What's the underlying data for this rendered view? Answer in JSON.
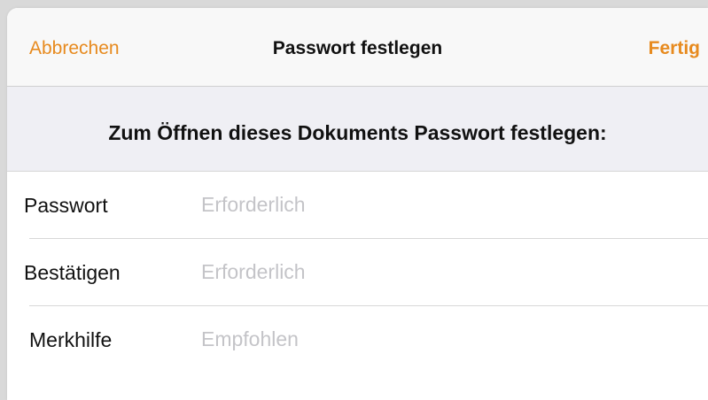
{
  "navbar": {
    "cancel_label": "Abbrechen",
    "title": "Passwort festlegen",
    "done_label": "Fertig"
  },
  "section": {
    "caption": "Zum Öffnen dieses Dokuments Passwort festlegen:"
  },
  "fields": [
    {
      "label": "Passwort",
      "value": "",
      "placeholder": "Erforderlich"
    },
    {
      "label": "Bestätigen",
      "value": "",
      "placeholder": "Erforderlich"
    },
    {
      "label": "Merkhilfe",
      "value": "",
      "placeholder": "Empfohlen"
    }
  ],
  "colors": {
    "accent": "#e78a1e",
    "navbar_bg": "#f8f8f8",
    "section_bg": "#efeff4",
    "placeholder": "#c4c4c8"
  }
}
